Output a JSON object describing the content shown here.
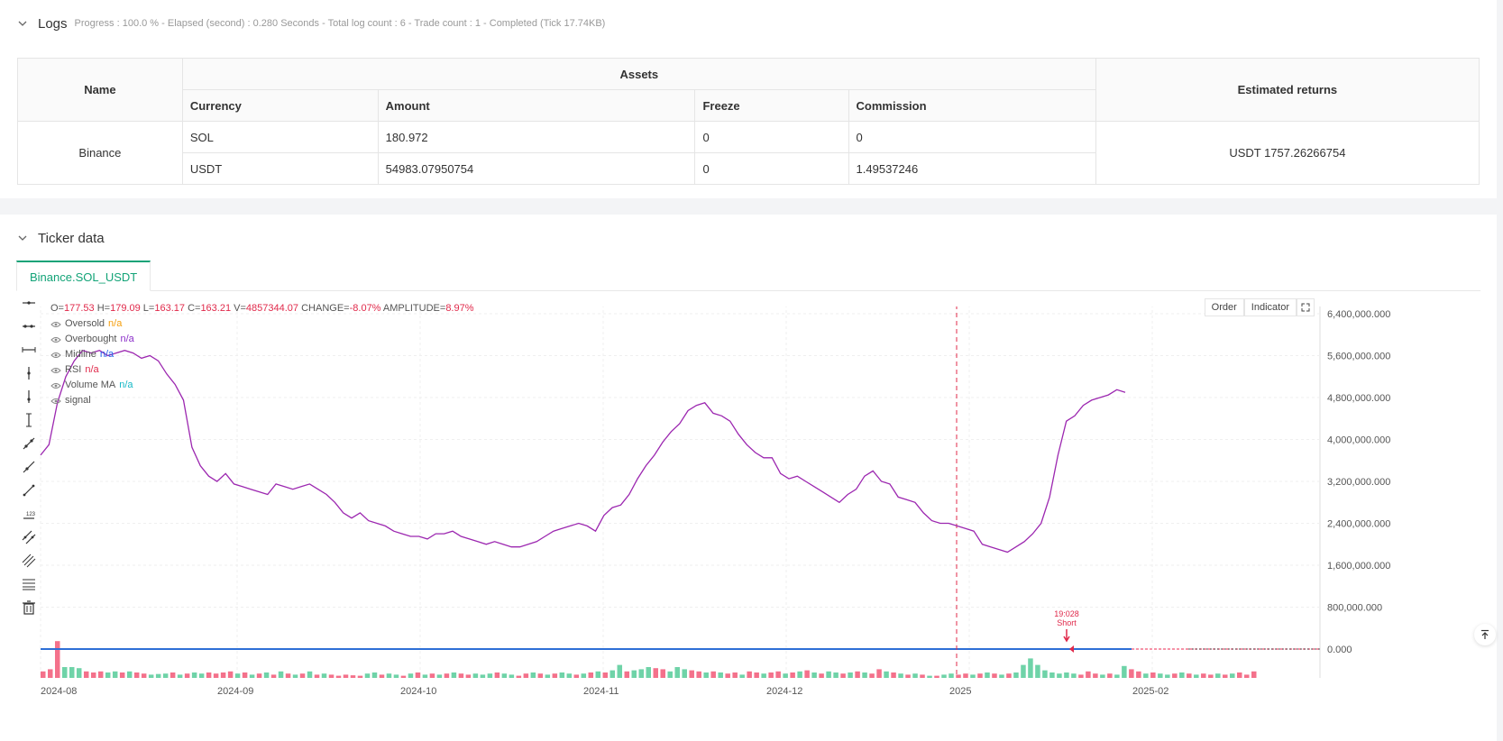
{
  "logs": {
    "title": "Logs",
    "meta": "Progress : 100.0 % - Elapsed (second) : 0.280  Seconds - Total log count : 6 - Trade count : 1 - Completed (Tick 17.74KB)"
  },
  "assets_table": {
    "name_header": "Name",
    "assets_header": "Assets",
    "returns_header": "Estimated returns",
    "sub_headers": [
      "Currency",
      "Amount",
      "Freeze",
      "Commission"
    ],
    "exchange": "Binance",
    "rows": [
      {
        "currency": "SOL",
        "amount": "180.972",
        "freeze": "0",
        "commission": "0"
      },
      {
        "currency": "USDT",
        "amount": "54983.07950754",
        "freeze": "0",
        "commission": "1.49537246"
      }
    ],
    "estimated_returns": "USDT 1757.26266754"
  },
  "ticker": {
    "title": "Ticker data",
    "tab": "Binance.SOL_USDT"
  },
  "legend": {
    "o_label": "O=",
    "o": "177.53",
    "h_label": "H=",
    "h": "179.09",
    "l_label": "L=",
    "l": "163.17",
    "c_label": "C=",
    "c": "163.21",
    "v_label": "V=",
    "v": "4857344.07",
    "change_label": "CHANGE=",
    "change": "-8.07%",
    "amp_label": "AMPLITUDE=",
    "amp": "8.97%",
    "indicators": [
      {
        "name": "Oversold",
        "value": "n/a",
        "cls": "na-orange"
      },
      {
        "name": "Overbought",
        "value": "n/a",
        "cls": "na-purple"
      },
      {
        "name": "Midline",
        "value": "n/a",
        "cls": "na-blue"
      },
      {
        "name": "RSI",
        "value": "n/a",
        "cls": "na-red"
      },
      {
        "name": "Volume MA",
        "value": "n/a",
        "cls": "na-teal"
      },
      {
        "name": "signal",
        "value": "",
        "cls": ""
      }
    ]
  },
  "chart_buttons": {
    "order": "Order",
    "indicator": "Indicator"
  },
  "chart_data": {
    "type": "line",
    "y_ticks": [
      "6,400,000.000",
      "5,600,000.000",
      "4,800,000.000",
      "4,000,000.000",
      "3,200,000.000",
      "2,400,000.000",
      "1,600,000.000",
      "800,000.000",
      "0.000"
    ],
    "y_tick_values": [
      6400000,
      5600000,
      4800000,
      4000000,
      3200000,
      2400000,
      1600000,
      800000,
      0
    ],
    "ylim": [
      0,
      6400000
    ],
    "x_ticks": [
      "2024-08",
      "2024-09",
      "2024-10",
      "2024-11",
      "2024-12",
      "2025",
      "2025-02"
    ],
    "line_color": "#9c27b0",
    "volume_ma": [
      3700000,
      3900000,
      4700000,
      5200000,
      5500000,
      5700000,
      5650000,
      5700000,
      5600000,
      5650000,
      5700000,
      5650000,
      5550000,
      5600000,
      5500000,
      5250000,
      5050000,
      4750000,
      3850000,
      3500000,
      3300000,
      3200000,
      3350000,
      3150000,
      3100000,
      3050000,
      3000000,
      2950000,
      3150000,
      3100000,
      3050000,
      3100000,
      3150000,
      3050000,
      2950000,
      2800000,
      2600000,
      2500000,
      2600000,
      2450000,
      2400000,
      2350000,
      2250000,
      2200000,
      2150000,
      2150000,
      2100000,
      2200000,
      2200000,
      2250000,
      2150000,
      2100000,
      2050000,
      2000000,
      2050000,
      2000000,
      1950000,
      1950000,
      2000000,
      2050000,
      2150000,
      2250000,
      2300000,
      2350000,
      2400000,
      2350000,
      2250000,
      2550000,
      2700000,
      2750000,
      2950000,
      3250000,
      3500000,
      3700000,
      3950000,
      4150000,
      4300000,
      4550000,
      4650000,
      4700000,
      4500000,
      4450000,
      4350000,
      4100000,
      3900000,
      3750000,
      3650000,
      3650000,
      3350000,
      3250000,
      3300000,
      3200000,
      3100000,
      3000000,
      2900000,
      2800000,
      2950000,
      3050000,
      3300000,
      3400000,
      3200000,
      3150000,
      2900000,
      2850000,
      2800000,
      2600000,
      2450000,
      2400000,
      2400000,
      2350000,
      2300000,
      2250000,
      2000000,
      1950000,
      1900000,
      1850000,
      1950000,
      2050000,
      2200000,
      2400000,
      2900000,
      3700000,
      4350000,
      4450000,
      4650000,
      4750000,
      4800000,
      4850000,
      4950000,
      4900000
    ],
    "volume_bars": [
      {
        "v": 0.3,
        "up": false
      },
      {
        "v": 0.4,
        "up": false
      },
      {
        "v": 1.7,
        "up": false
      },
      {
        "v": 0.5,
        "up": true
      },
      {
        "v": 0.5,
        "up": true
      },
      {
        "v": 0.45,
        "up": true
      },
      {
        "v": 0.3,
        "up": false
      },
      {
        "v": 0.25,
        "up": false
      },
      {
        "v": 0.3,
        "up": false
      },
      {
        "v": 0.25,
        "up": true
      },
      {
        "v": 0.3,
        "up": true
      },
      {
        "v": 0.25,
        "up": false
      },
      {
        "v": 0.3,
        "up": true
      },
      {
        "v": 0.25,
        "up": false
      },
      {
        "v": 0.2,
        "up": false
      },
      {
        "v": 0.15,
        "up": true
      },
      {
        "v": 0.18,
        "up": true
      },
      {
        "v": 0.2,
        "up": true
      },
      {
        "v": 0.25,
        "up": false
      },
      {
        "v": 0.15,
        "up": true
      },
      {
        "v": 0.2,
        "up": false
      },
      {
        "v": 0.25,
        "up": true
      },
      {
        "v": 0.2,
        "up": true
      },
      {
        "v": 0.25,
        "up": false
      },
      {
        "v": 0.2,
        "up": false
      },
      {
        "v": 0.25,
        "up": false
      },
      {
        "v": 0.3,
        "up": false
      },
      {
        "v": 0.2,
        "up": true
      },
      {
        "v": 0.25,
        "up": false
      },
      {
        "v": 0.15,
        "up": true
      },
      {
        "v": 0.2,
        "up": false
      },
      {
        "v": 0.25,
        "up": true
      },
      {
        "v": 0.15,
        "up": false
      },
      {
        "v": 0.3,
        "up": true
      },
      {
        "v": 0.2,
        "up": false
      },
      {
        "v": 0.15,
        "up": true
      },
      {
        "v": 0.2,
        "up": false
      },
      {
        "v": 0.3,
        "up": true
      },
      {
        "v": 0.15,
        "up": false
      },
      {
        "v": 0.2,
        "up": true
      },
      {
        "v": 0.15,
        "up": false
      },
      {
        "v": 0.1,
        "up": false
      },
      {
        "v": 0.15,
        "up": false
      },
      {
        "v": 0.12,
        "up": false
      },
      {
        "v": 0.1,
        "up": false
      },
      {
        "v": 0.2,
        "up": true
      },
      {
        "v": 0.25,
        "up": true
      },
      {
        "v": 0.15,
        "up": false
      },
      {
        "v": 0.2,
        "up": true
      },
      {
        "v": 0.15,
        "up": true
      },
      {
        "v": 0.1,
        "up": false
      },
      {
        "v": 0.2,
        "up": true
      },
      {
        "v": 0.25,
        "up": false
      },
      {
        "v": 0.15,
        "up": true
      },
      {
        "v": 0.2,
        "up": false
      },
      {
        "v": 0.15,
        "up": true
      },
      {
        "v": 0.2,
        "up": false
      },
      {
        "v": 0.25,
        "up": true
      },
      {
        "v": 0.2,
        "up": false
      },
      {
        "v": 0.15,
        "up": false
      },
      {
        "v": 0.2,
        "up": true
      },
      {
        "v": 0.15,
        "up": true
      },
      {
        "v": 0.2,
        "up": true
      },
      {
        "v": 0.25,
        "up": false
      },
      {
        "v": 0.2,
        "up": true
      },
      {
        "v": 0.15,
        "up": true
      },
      {
        "v": 0.1,
        "up": false
      },
      {
        "v": 0.2,
        "up": false
      },
      {
        "v": 0.25,
        "up": true
      },
      {
        "v": 0.2,
        "up": false
      },
      {
        "v": 0.15,
        "up": true
      },
      {
        "v": 0.2,
        "up": false
      },
      {
        "v": 0.25,
        "up": true
      },
      {
        "v": 0.2,
        "up": true
      },
      {
        "v": 0.15,
        "up": false
      },
      {
        "v": 0.2,
        "up": true
      },
      {
        "v": 0.25,
        "up": false
      },
      {
        "v": 0.3,
        "up": true
      },
      {
        "v": 0.25,
        "up": false
      },
      {
        "v": 0.35,
        "up": true
      },
      {
        "v": 0.6,
        "up": true
      },
      {
        "v": 0.3,
        "up": false
      },
      {
        "v": 0.35,
        "up": true
      },
      {
        "v": 0.4,
        "up": true
      },
      {
        "v": 0.5,
        "up": true
      },
      {
        "v": 0.45,
        "up": false
      },
      {
        "v": 0.4,
        "up": false
      },
      {
        "v": 0.3,
        "up": true
      },
      {
        "v": 0.5,
        "up": true
      },
      {
        "v": 0.4,
        "up": true
      },
      {
        "v": 0.35,
        "up": false
      },
      {
        "v": 0.3,
        "up": false
      },
      {
        "v": 0.25,
        "up": true
      },
      {
        "v": 0.3,
        "up": false
      },
      {
        "v": 0.25,
        "up": true
      },
      {
        "v": 0.2,
        "up": false
      },
      {
        "v": 0.25,
        "up": false
      },
      {
        "v": 0.15,
        "up": true
      },
      {
        "v": 0.3,
        "up": false
      },
      {
        "v": 0.25,
        "up": false
      },
      {
        "v": 0.2,
        "up": true
      },
      {
        "v": 0.25,
        "up": false
      },
      {
        "v": 0.3,
        "up": false
      },
      {
        "v": 0.2,
        "up": true
      },
      {
        "v": 0.25,
        "up": false
      },
      {
        "v": 0.3,
        "up": true
      },
      {
        "v": 0.35,
        "up": false
      },
      {
        "v": 0.25,
        "up": true
      },
      {
        "v": 0.2,
        "up": false
      },
      {
        "v": 0.3,
        "up": true
      },
      {
        "v": 0.25,
        "up": true
      },
      {
        "v": 0.2,
        "up": false
      },
      {
        "v": 0.25,
        "up": true
      },
      {
        "v": 0.3,
        "up": false
      },
      {
        "v": 0.25,
        "up": true
      },
      {
        "v": 0.2,
        "up": false
      },
      {
        "v": 0.4,
        "up": false
      },
      {
        "v": 0.3,
        "up": true
      },
      {
        "v": 0.25,
        "up": false
      },
      {
        "v": 0.2,
        "up": true
      },
      {
        "v": 0.15,
        "up": false
      },
      {
        "v": 0.2,
        "up": true
      },
      {
        "v": 0.15,
        "up": false
      },
      {
        "v": 0.1,
        "up": true
      },
      {
        "v": 0.1,
        "up": false
      },
      {
        "v": 0.15,
        "up": true
      },
      {
        "v": 0.2,
        "up": true
      },
      {
        "v": 0.15,
        "up": false
      },
      {
        "v": 0.2,
        "up": false
      },
      {
        "v": 0.15,
        "up": true
      },
      {
        "v": 0.2,
        "up": false
      },
      {
        "v": 0.25,
        "up": true
      },
      {
        "v": 0.2,
        "up": false
      },
      {
        "v": 0.15,
        "up": true
      },
      {
        "v": 0.2,
        "up": false
      },
      {
        "v": 0.25,
        "up": true
      },
      {
        "v": 0.6,
        "up": true
      },
      {
        "v": 0.9,
        "up": true
      },
      {
        "v": 0.6,
        "up": true
      },
      {
        "v": 0.35,
        "up": true
      },
      {
        "v": 0.25,
        "up": true
      },
      {
        "v": 0.2,
        "up": true
      },
      {
        "v": 0.25,
        "up": true
      },
      {
        "v": 0.2,
        "up": true
      },
      {
        "v": 0.15,
        "up": false
      },
      {
        "v": 0.3,
        "up": false
      },
      {
        "v": 0.2,
        "up": false
      },
      {
        "v": 0.15,
        "up": true
      },
      {
        "v": 0.2,
        "up": false
      },
      {
        "v": 0.15,
        "up": true
      },
      {
        "v": 0.55,
        "up": true
      },
      {
        "v": 0.4,
        "up": false
      },
      {
        "v": 0.3,
        "up": false
      },
      {
        "v": 0.2,
        "up": true
      },
      {
        "v": 0.25,
        "up": false
      },
      {
        "v": 0.2,
        "up": true
      },
      {
        "v": 0.15,
        "up": true
      },
      {
        "v": 0.2,
        "up": false
      },
      {
        "v": 0.25,
        "up": true
      },
      {
        "v": 0.2,
        "up": false
      },
      {
        "v": 0.15,
        "up": true
      },
      {
        "v": 0.2,
        "up": false
      },
      {
        "v": 0.15,
        "up": false
      },
      {
        "v": 0.2,
        "up": true
      },
      {
        "v": 0.15,
        "up": false
      },
      {
        "v": 0.2,
        "up": true
      },
      {
        "v": 0.25,
        "up": false
      },
      {
        "v": 0.15,
        "up": false
      },
      {
        "v": 0.3,
        "up": false
      }
    ],
    "signal": {
      "label_top": "19:028",
      "label_bottom": "Short"
    }
  }
}
